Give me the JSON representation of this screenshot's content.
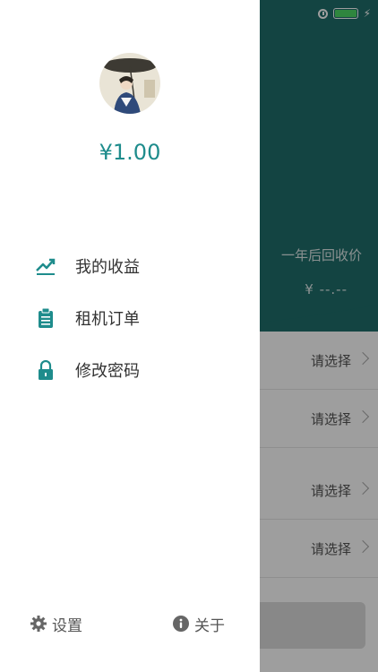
{
  "drawer": {
    "balance": "¥1.00",
    "menu": [
      {
        "label": "我的收益",
        "icon": "earnings-trend-icon"
      },
      {
        "label": "租机订单",
        "icon": "clipboard-icon"
      },
      {
        "label": "修改密码",
        "icon": "lock-icon"
      }
    ],
    "footer": {
      "settings_label": "设置",
      "about_label": "关于"
    }
  },
  "background_page": {
    "recycle_label": "一年后回收价",
    "price_placeholder": "¥ --.--",
    "rows": [
      {
        "value": "请选择"
      },
      {
        "value": "请选择"
      },
      {
        "value": "请选择"
      },
      {
        "value": "请选择"
      }
    ]
  },
  "colors": {
    "accent": "#1e8c8c",
    "header": "#1f6e6b"
  }
}
